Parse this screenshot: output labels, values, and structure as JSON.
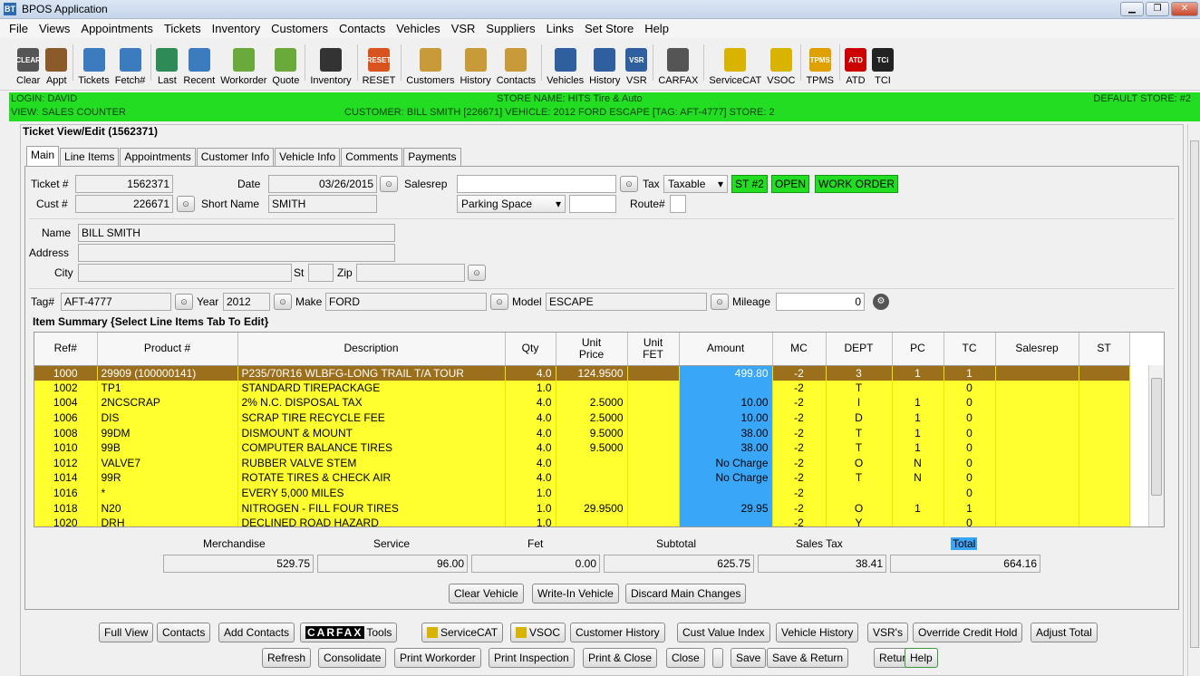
{
  "window": {
    "title": "BPOS Application",
    "icon": "BT"
  },
  "menu": [
    "File",
    "Views",
    "Appointments",
    "Tickets",
    "Inventory",
    "Customers",
    "Contacts",
    "Vehicles",
    "VSR",
    "Suppliers",
    "Links",
    "Set Store",
    "Help"
  ],
  "toolbar": [
    {
      "label": "Clear",
      "icon": "CLEAR",
      "color": "#555555"
    },
    {
      "label": "Appt",
      "icon": "calendar-icon",
      "color": "#8a5a2a"
    },
    {
      "label": "Tickets",
      "icon": "ticket-icon",
      "color": "#3d7bbf"
    },
    {
      "label": "Fetch#",
      "icon": "fetch-icon",
      "color": "#3d7bbf"
    },
    {
      "label": "Last",
      "icon": "arrow-left-icon",
      "color": "#2e8b57"
    },
    {
      "label": "Recent",
      "icon": "recent-icon",
      "color": "#3d7bbf"
    },
    {
      "label": "Workorder",
      "icon": "workorder-icon",
      "color": "#6aaa3a"
    },
    {
      "label": "Quote",
      "icon": "quote-icon",
      "color": "#6aaa3a"
    },
    {
      "label": "Inventory",
      "icon": "tire-icon",
      "color": "#333333"
    },
    {
      "label": "RESET",
      "icon": "RESET",
      "color": "#d9531e"
    },
    {
      "label": "Customers",
      "icon": "customer-icon",
      "color": "#c89a3a"
    },
    {
      "label": "History",
      "icon": "history-icon",
      "color": "#c89a3a"
    },
    {
      "label": "Contacts",
      "icon": "contacts-icon",
      "color": "#c89a3a"
    },
    {
      "label": "Vehicles",
      "icon": "vehicle-icon",
      "color": "#2f5f9f"
    },
    {
      "label": "History",
      "icon": "vehicle-history-icon",
      "color": "#2f5f9f"
    },
    {
      "label": "VSR",
      "icon": "VSR",
      "color": "#2f5f9f"
    },
    {
      "label": "CARFAX",
      "icon": "carfax-icon",
      "color": "#555555"
    },
    {
      "label": "ServiceCAT",
      "icon": "servicecat-icon",
      "color": "#d8b400"
    },
    {
      "label": "VSOC",
      "icon": "vsoc-icon",
      "color": "#d8b400"
    },
    {
      "label": "TPMS",
      "icon": "TPMS",
      "color": "#e0a000"
    },
    {
      "label": "ATD",
      "icon": "ATD",
      "color": "#cc0000"
    },
    {
      "label": "TCI",
      "icon": "TCi",
      "color": "#222222"
    }
  ],
  "status": {
    "login": "LOGIN: DAVID",
    "view": "VIEW: SALES COUNTER",
    "store_name": "STORE NAME: HITS Tire & Auto",
    "customer_line": "CUSTOMER: BILL SMITH [226671]   VEHICLE: 2012 FORD ESCAPE [TAG: AFT-4777]   STORE: 2",
    "default_store": "DEFAULT STORE: #2"
  },
  "panel_title": "Ticket View/Edit  (1562371)",
  "tabs": [
    "Main",
    "Line Items",
    "Appointments",
    "Customer Info",
    "Vehicle Info",
    "Comments",
    "Payments"
  ],
  "form": {
    "ticket_label": "Ticket #",
    "ticket": "1562371",
    "date_label": "Date",
    "date": "03/26/2015",
    "salesrep_label": "Salesrep",
    "salesrep": "",
    "tax_label": "Tax",
    "tax": "Taxable",
    "badges": [
      "ST #2",
      "OPEN",
      "WORK ORDER"
    ],
    "cust_label": "Cust #",
    "cust": "226671",
    "shortname_label": "Short Name",
    "shortname": "SMITH",
    "parking": "Parking Space",
    "route_label": "Route#",
    "name_label": "Name",
    "name": "BILL SMITH",
    "address_label": "Address",
    "address": "",
    "city_label": "City",
    "city": "",
    "st_label": "St",
    "st": "",
    "zip_label": "Zip",
    "zip": "",
    "tag_label": "Tag#",
    "tag": "AFT-4777",
    "year_label": "Year",
    "year": "2012",
    "make_label": "Make",
    "make": "FORD",
    "model_label": "Model",
    "model": "ESCAPE",
    "mileage_label": "Mileage",
    "mileage": "0"
  },
  "item_summary_label": "Item Summary {Select Line Items Tab To Edit}",
  "columns": [
    "Ref#",
    "Product #",
    "Description",
    "Qty",
    "Unit\nPrice",
    "Unit\nFET",
    "Amount",
    "MC",
    "DEPT",
    "PC",
    "TC",
    "Salesrep",
    "ST"
  ],
  "items": [
    {
      "ref": "1000",
      "product": "29909 (100000141)",
      "desc": "P235/70R16 WLBFG-LONG TRAIL T/A TOUR",
      "qty": "4.0",
      "price": "124.9500",
      "fet": "",
      "amount": "499.80",
      "mc": "-2",
      "dept": "3",
      "pc": "1",
      "tc": "1",
      "selected": true
    },
    {
      "ref": "1002",
      "product": "TP1",
      "desc": "STANDARD TIREPACKAGE",
      "qty": "1.0",
      "price": "",
      "fet": "",
      "amount": "",
      "mc": "-2",
      "dept": "T",
      "pc": "",
      "tc": "0"
    },
    {
      "ref": "1004",
      "product": "2NCSCRAP",
      "desc": "2% N.C. DISPOSAL TAX",
      "qty": "4.0",
      "price": "2.5000",
      "fet": "",
      "amount": "10.00",
      "mc": "-2",
      "dept": "I",
      "pc": "1",
      "tc": "0"
    },
    {
      "ref": "1006",
      "product": "DIS",
      "desc": "SCRAP TIRE RECYCLE FEE",
      "qty": "4.0",
      "price": "2.5000",
      "fet": "",
      "amount": "10.00",
      "mc": "-2",
      "dept": "D",
      "pc": "1",
      "tc": "0"
    },
    {
      "ref": "1008",
      "product": "99DM",
      "desc": "DISMOUNT & MOUNT",
      "qty": "4.0",
      "price": "9.5000",
      "fet": "",
      "amount": "38.00",
      "mc": "-2",
      "dept": "T",
      "pc": "1",
      "tc": "0"
    },
    {
      "ref": "1010",
      "product": "99B",
      "desc": "COMPUTER BALANCE TIRES",
      "qty": "4.0",
      "price": "9.5000",
      "fet": "",
      "amount": "38.00",
      "mc": "-2",
      "dept": "T",
      "pc": "1",
      "tc": "0"
    },
    {
      "ref": "1012",
      "product": "VALVE7",
      "desc": "RUBBER VALVE STEM",
      "qty": "4.0",
      "price": "",
      "fet": "",
      "amount": "No Charge",
      "mc": "-2",
      "dept": "O",
      "pc": "N",
      "tc": "0"
    },
    {
      "ref": "1014",
      "product": "99R",
      "desc": "ROTATE TIRES & CHECK AIR",
      "qty": "4.0",
      "price": "",
      "fet": "",
      "amount": "No Charge",
      "mc": "-2",
      "dept": "T",
      "pc": "N",
      "tc": "0"
    },
    {
      "ref": "1016",
      "product": "*",
      "desc": "EVERY 5,000  MILES",
      "qty": "1.0",
      "price": "",
      "fet": "",
      "amount": "",
      "mc": "-2",
      "dept": "",
      "pc": "",
      "tc": "0"
    },
    {
      "ref": "1018",
      "product": "N20",
      "desc": "NITROGEN - FILL FOUR TIRES",
      "qty": "1.0",
      "price": "29.9500",
      "fet": "",
      "amount": "29.95",
      "mc": "-2",
      "dept": "O",
      "pc": "1",
      "tc": "1"
    },
    {
      "ref": "1020",
      "product": "DRH",
      "desc": "DECLINED ROAD HAZARD",
      "qty": "1.0",
      "price": "",
      "fet": "",
      "amount": "",
      "mc": "-2",
      "dept": "Y",
      "pc": "",
      "tc": "0"
    }
  ],
  "totals": {
    "merchandise_label": "Merchandise",
    "merchandise": "529.75",
    "service_label": "Service",
    "service": "96.00",
    "fet_label": "Fet",
    "fet": "0.00",
    "subtotal_label": "Subtotal",
    "subtotal": "625.75",
    "salestax_label": "Sales Tax",
    "salestax": "38.41",
    "total_label": "Total",
    "total": "664.16"
  },
  "vehicle_buttons": [
    "Clear Vehicle",
    "Write-In Vehicle",
    "Discard Main Changes"
  ],
  "bottom_row1": [
    "Full View",
    "Contacts",
    "Add Contacts",
    "CARFAX Tools",
    "ServiceCAT",
    "VSOC",
    "Customer History",
    "Cust Value Index",
    "Vehicle History",
    "VSR's",
    "Override Credit Hold",
    "Adjust Total"
  ],
  "bottom_row2": [
    "Refresh",
    "Consolidate",
    "Print Workorder",
    "Print Inspection",
    "Print & Close",
    "Close",
    "",
    "Save",
    "Save & Return",
    "Return",
    "Help"
  ],
  "carfax_logo": "CARFAX",
  "colors": {
    "status_green": "#22dd22",
    "row_yellow": "#ffff30",
    "selected_row": "#9c6f1c",
    "amount_blue": "#3aa6f8"
  }
}
